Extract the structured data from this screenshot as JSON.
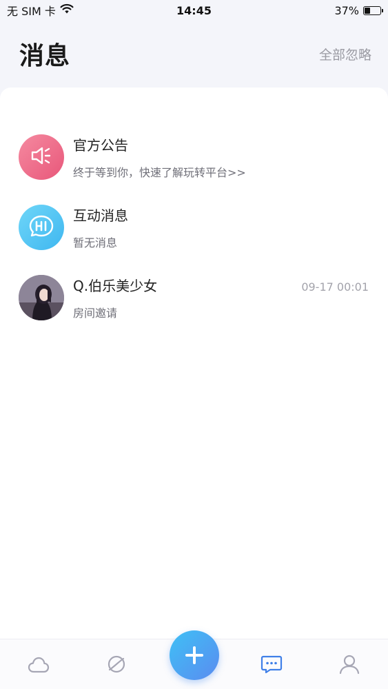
{
  "status_bar": {
    "carrier": "无 SIM 卡",
    "time": "14:45",
    "battery": "37%",
    "battery_level": 0.37
  },
  "header": {
    "title": "消息",
    "dismiss_all": "全部忽略"
  },
  "messages": [
    {
      "title": "官方公告",
      "preview": "终于等到你，快速了解玩转平台>>",
      "time": "",
      "icon": "speaker-icon",
      "color": "#ee6f8c"
    },
    {
      "title": "互动消息",
      "preview": "暂无消息",
      "time": "",
      "icon": "hi-bubble-icon",
      "color": "#4cc3f3"
    },
    {
      "title": "Q.伯乐美少女",
      "preview": "房间邀请",
      "time": "09-17 00:01",
      "icon": "user-avatar",
      "color": ""
    }
  ],
  "bottom_nav": {
    "items": [
      "cloud-icon",
      "planet-icon",
      "plus-icon",
      "chat-icon",
      "profile-icon"
    ],
    "active_color": "#3f7fe8",
    "inactive_color": "#a6a6b4"
  }
}
